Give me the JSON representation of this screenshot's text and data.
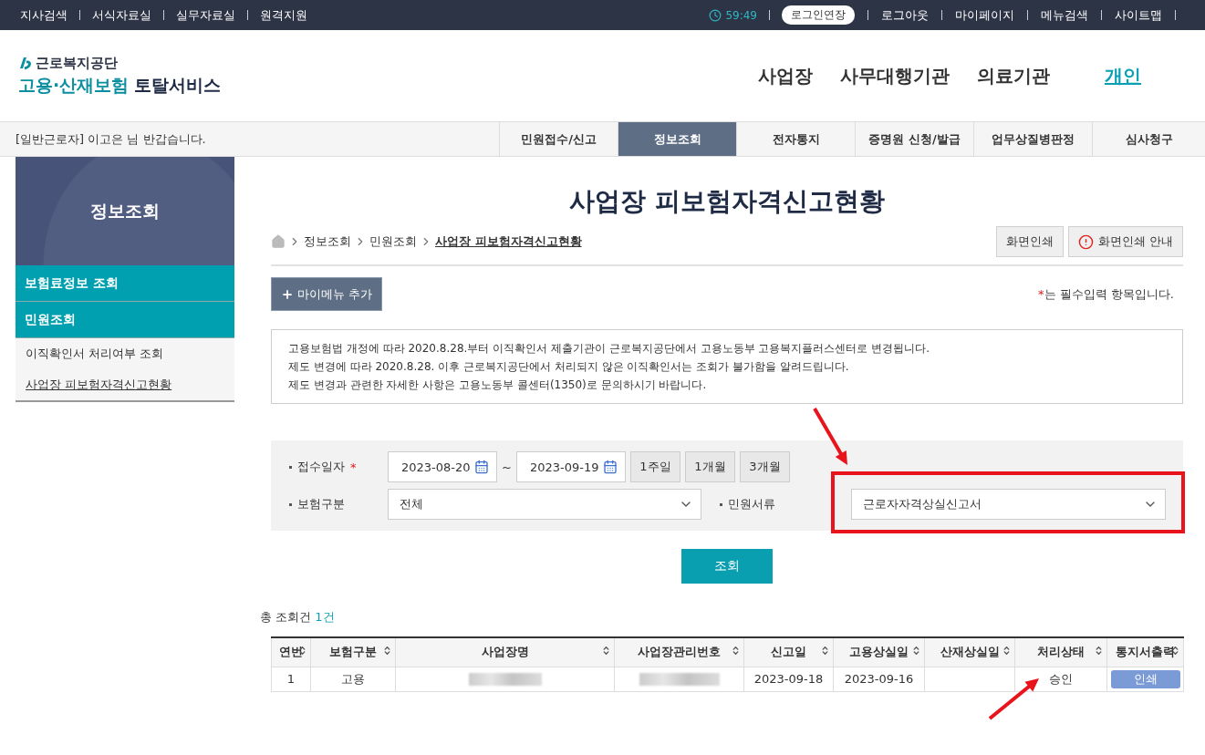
{
  "top_bar": {
    "links": [
      "지사검색",
      "서식자료실",
      "실무자료실",
      "원격지원"
    ],
    "timer": "59:49",
    "extend_button": "로그인연장",
    "user_links": [
      "로그아웃",
      "마이페이지",
      "메뉴검색",
      "사이트맵"
    ]
  },
  "header": {
    "org": "근로복지공단",
    "service_main": "고용·산재보험",
    "service_sub": "토탈서비스",
    "nav": [
      {
        "label": "사업장",
        "selected": false
      },
      {
        "label": "사무대행기관",
        "selected": false
      },
      {
        "label": "의료기관",
        "selected": false
      },
      {
        "label": "개인",
        "selected": true
      }
    ]
  },
  "welcome": "[일반근로자] 이고은 님 반갑습니다.",
  "menu_tabs": [
    {
      "label": "민원접수/신고",
      "selected": false
    },
    {
      "label": "정보조회",
      "selected": true
    },
    {
      "label": "전자통지",
      "selected": false
    },
    {
      "label": "증명원 신청/발급",
      "selected": false
    },
    {
      "label": "업무상질병판정",
      "selected": false
    },
    {
      "label": "심사청구",
      "selected": false
    }
  ],
  "sidebar": {
    "title": "정보조회",
    "items": [
      {
        "label": "보험료정보 조회",
        "kind": "section",
        "selected": false
      },
      {
        "label": "민원조회",
        "kind": "section",
        "selected": false,
        "children": [
          {
            "label": "이직확인서 처리여부 조회",
            "selected": false
          },
          {
            "label": "사업장 피보험자격신고현황",
            "selected": true
          }
        ]
      }
    ]
  },
  "page_title": "사업장 피보험자격신고현황",
  "breadcrumb": [
    "정보조회",
    "민원조회",
    "사업장 피보험자격신고현황"
  ],
  "print_buttons": [
    {
      "label": "화면인쇄",
      "kind": "plain"
    },
    {
      "label": "화면인쇄 안내",
      "kind": "info"
    }
  ],
  "mymenu_button": "마이메뉴 추가",
  "required_note": {
    "mark": "*",
    "text": "는 필수입력 항목입니다."
  },
  "notice": [
    "고용보험법 개정에 따라 2020.8.28.부터 이직확인서 제출기관이 근로복지공단에서 고용노동부 고용복지플러스센터로 변경됩니다.",
    "제도 변경에 따라 2020.8.28. 이후 근로복지공단에서 처리되지 않은 이직확인서는 조회가 불가함을 알려드립니다.",
    "제도 변경과 관련한 자세한 사항은 고용노동부 콜센터(1350)로 문의하시기 바랍니다."
  ],
  "filters": {
    "date": {
      "label": "접수일자",
      "mark": "*",
      "from": "2023-08-20",
      "separator": "~",
      "to": "2023-09-19",
      "periods": [
        "1주일",
        "1개월",
        "3개월"
      ]
    },
    "insurance": {
      "label": "보험구분",
      "value": "전체"
    },
    "document": {
      "label": "민원서류",
      "value": "근로자자격상실신고서",
      "annotated": true
    }
  },
  "search_button": "조회",
  "total": {
    "label": "총 조회건",
    "count": "1건"
  },
  "table": {
    "columns": [
      "연번",
      "보험구분",
      "사업장명",
      "사업장관리번호",
      "신고일",
      "고용상실일",
      "산재상실일",
      "처리상태",
      "통지서출력"
    ],
    "rows": [
      {
        "no": "1",
        "insurance": "고용",
        "name_redacted": true,
        "number_redacted": true,
        "report_date": "2023-09-18",
        "loss_date": "2023-09-16",
        "status": "승인",
        "status_annotated": true,
        "print": "인쇄"
      }
    ]
  }
}
